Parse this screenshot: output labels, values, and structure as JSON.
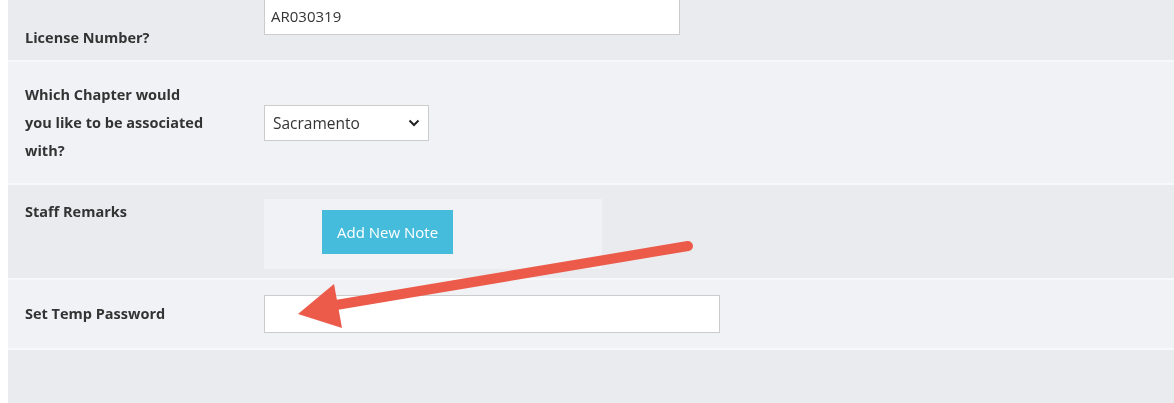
{
  "rows": [
    {
      "kind": "text",
      "label": "License Number?",
      "value": "AR030319"
    },
    {
      "kind": "select",
      "label": "Which Chapter would you like to be associated with?",
      "value": "Sacramento"
    },
    {
      "kind": "notes",
      "label": "Staff Remarks",
      "button": "Add New Note"
    },
    {
      "kind": "text",
      "label": "Set Temp Password",
      "value": ""
    }
  ]
}
